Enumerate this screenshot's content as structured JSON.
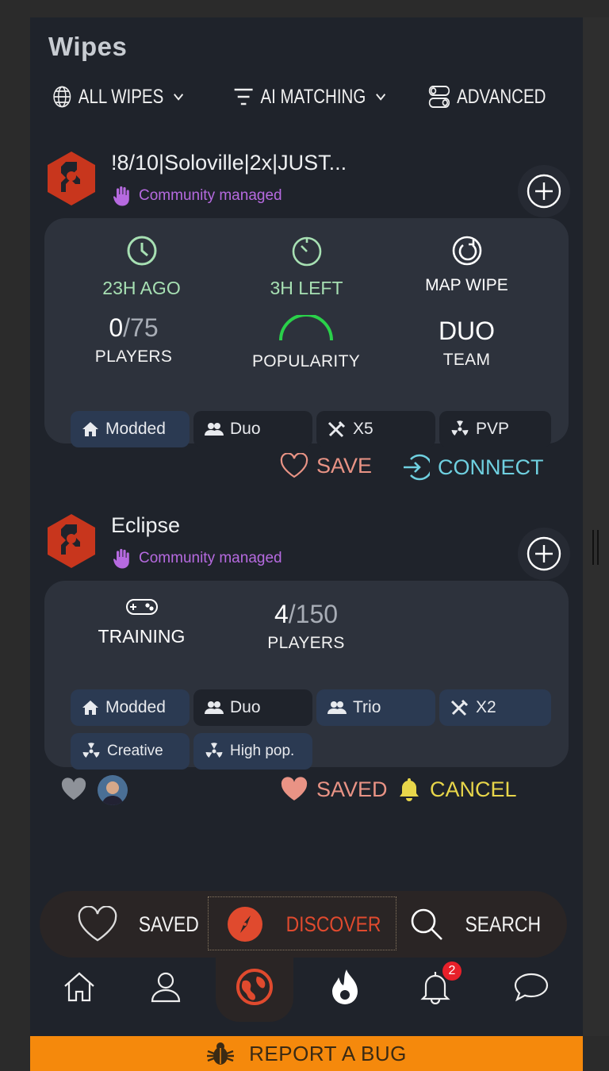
{
  "page": {
    "title": "Wipes"
  },
  "filters": {
    "all_wipes": "ALL WIPES",
    "ai_matching": "AI MATCHING",
    "advanced": "ADVANCED"
  },
  "cards": [
    {
      "name": "!8/10|Soloville|2x|JUST...",
      "community": "Community managed",
      "stats": {
        "last_wipe": "23H AGO",
        "time_left": "3H LEFT",
        "wipe_type": "MAP WIPE",
        "players_current": "0",
        "players_max": "/75",
        "players_label": "PLAYERS",
        "popularity_label": "POPULARITY",
        "popularity_level": 0.5,
        "team_value": "DUO",
        "team_label": "TEAM"
      },
      "tags": [
        "Modded",
        "Duo",
        "X5",
        "PVP"
      ],
      "actions": {
        "save": "SAVE",
        "connect": "CONNECT"
      }
    },
    {
      "name": "Eclipse",
      "community": "Community managed",
      "stats": {
        "mode": "TRAINING",
        "players_current": "4",
        "players_max": "/150",
        "players_label": "PLAYERS"
      },
      "tags": [
        "Modded",
        "Duo",
        "Trio",
        "X2",
        "Creative",
        "High pop."
      ],
      "actions": {
        "saved": "SAVED",
        "cancel": "CANCEL"
      }
    }
  ],
  "bottom_nav": {
    "saved": "SAVED",
    "discover": "DISCOVER",
    "search": "SEARCH"
  },
  "tabbar": {
    "notification_count": "2"
  },
  "report_bug": "REPORT A BUG",
  "colors": {
    "accent_orange": "#f5890c",
    "community_purple": "#b66ae0",
    "connect_cyan": "#6fd0e0",
    "save_pink": "#e99385",
    "cancel_yellow": "#e8d64a",
    "discover_red": "#e04a2e"
  }
}
